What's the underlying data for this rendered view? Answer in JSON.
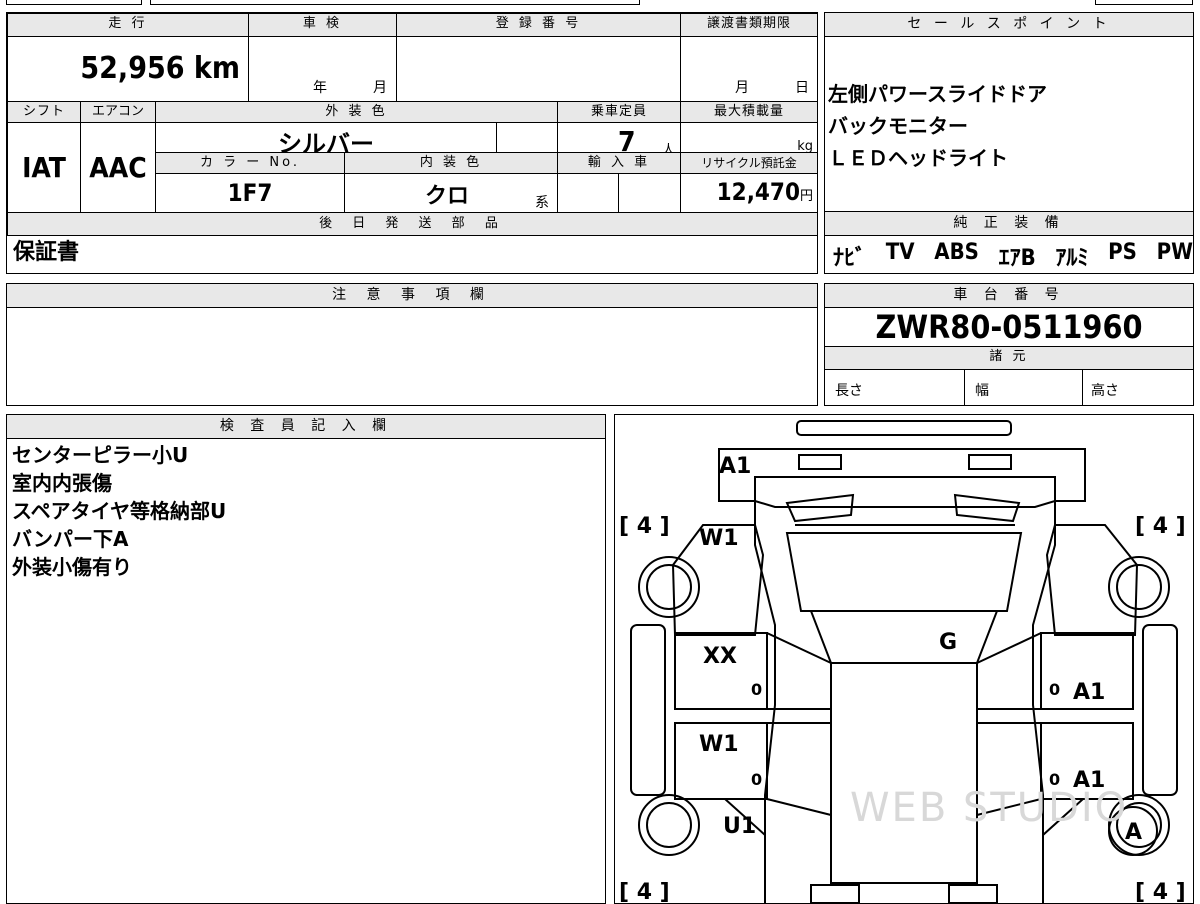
{
  "top_section": {
    "labels": {
      "mileage": "走 行",
      "shaken": "車 検",
      "registration": "登 録 番 号",
      "transfer_deadline": "譲渡書類期限",
      "shift": "シフト",
      "aircon": "エアコン",
      "exterior_color": "外 装 色",
      "capacity": "乗車定員",
      "max_load": "最大積載量",
      "color_no": "カ ラ ー No.",
      "interior_color": "内 装 色",
      "import": "輸 入 車",
      "recycle": "リサイクル預託金",
      "later_parts": "後 日 発 送 部 品"
    },
    "mileage_value": "52,956",
    "mileage_unit": "km",
    "shaken_year": "年",
    "shaken_month": "月",
    "transfer_month": "月",
    "transfer_day": "日",
    "shift_value": "IAT",
    "aircon_value": "AAC",
    "exterior_color_value": "シルバー",
    "capacity_value": "7",
    "capacity_unit": "人",
    "max_load_unit": "kg",
    "color_no_value": "1F7",
    "interior_color_value": "クロ",
    "interior_color_suffix": "系",
    "recycle_value": "12,470",
    "recycle_unit": "円",
    "later_parts_value": "保証書"
  },
  "sales_points": {
    "title": "セ ー ル ス ポ イ ン ト",
    "items": [
      "左側パワースライドドア",
      "バックモニター",
      "ＬＥＤヘッドライト"
    ]
  },
  "equipment": {
    "title": "純 正 装 備",
    "items": [
      "ﾅﾋﾞ",
      "TV",
      "ABS",
      "ｴｱB",
      "ｱﾙﾐ",
      "PS",
      "PW"
    ]
  },
  "notes": {
    "title": "注 意 事 項 欄"
  },
  "chassis": {
    "title": "車 台 番 号",
    "value": "ZWR80-0511960",
    "spec_title": "諸 元",
    "length": "長さ",
    "width": "幅",
    "height": "高さ"
  },
  "inspector": {
    "title": "検 査 員 記 入 欄",
    "lines": [
      "センターピラー小U",
      "室内内張傷",
      "スペアタイヤ等格納部U",
      "バンパー下A",
      "外装小傷有り"
    ]
  },
  "diagram": {
    "tread_tl": "[ 4 ]",
    "tread_tr": "[ 4 ]",
    "tread_bl": "[ 4 ]",
    "tread_br": "[ 4 ]",
    "marks": {
      "front_bumper": "A1",
      "front_left": "W1",
      "roof": "G",
      "left_front_door": "XX",
      "left_front_door_num": "0",
      "left_rear_door": "W1",
      "left_rear_door_num": "0",
      "right_front_door": "A1",
      "right_front_door_num": "0",
      "right_rear_door": "A1",
      "right_rear_door_num": "0",
      "rear_left": "U1",
      "right_rear_wheel": "A"
    }
  },
  "watermark": "WEB STUDIO"
}
